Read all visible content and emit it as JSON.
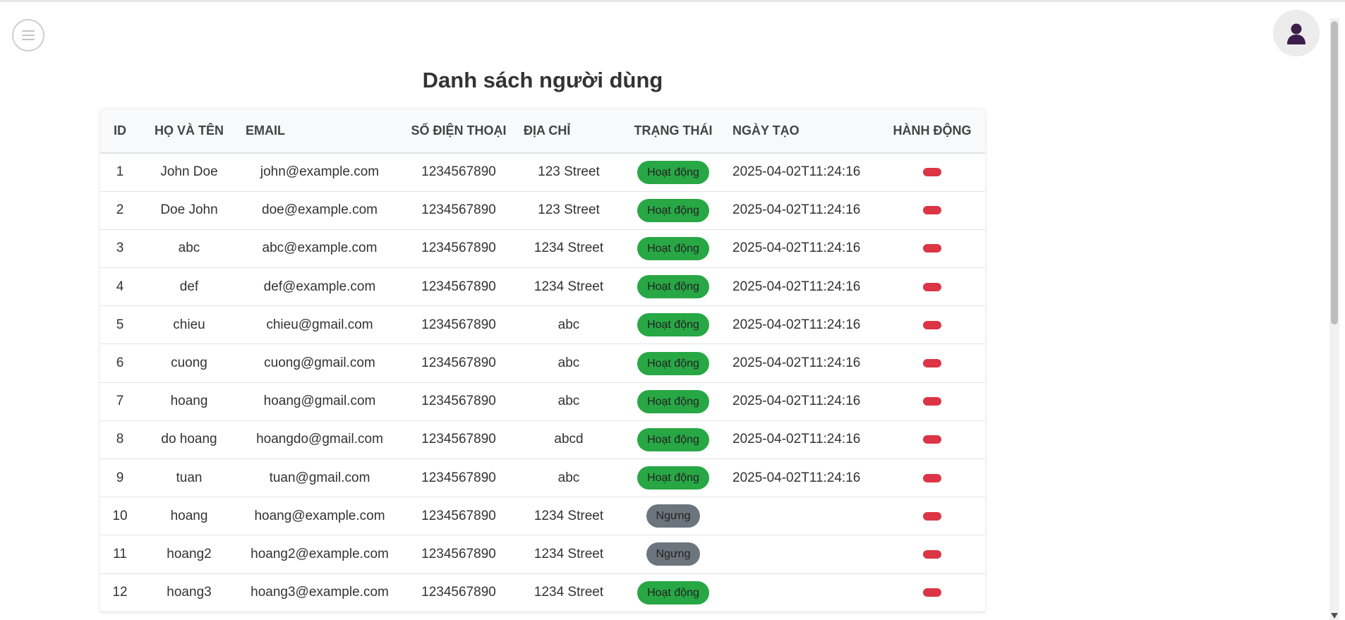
{
  "page": {
    "title": "Danh sách người dùng"
  },
  "header": {
    "menu_icon": "hamburger-icon",
    "avatar_icon": "user-avatar-icon"
  },
  "table": {
    "columns": [
      "ID",
      "HỌ VÀ TÊN",
      "EMAIL",
      "SỐ ĐIỆN THOẠI",
      "ĐỊA CHỈ",
      "TRẠNG THÁI",
      "NGÀY TẠO",
      "HÀNH ĐỘNG"
    ],
    "rows": [
      {
        "id": "1",
        "name": "John Doe",
        "email": "john@example.com",
        "phone": "1234567890",
        "address": "123 Street",
        "status": "Hoạt động",
        "status_type": "active",
        "created": "2025-04-02T11:24:16"
      },
      {
        "id": "2",
        "name": "Doe John",
        "email": "doe@example.com",
        "phone": "1234567890",
        "address": "123 Street",
        "status": "Hoạt động",
        "status_type": "active",
        "created": "2025-04-02T11:24:16"
      },
      {
        "id": "3",
        "name": "abc",
        "email": "abc@example.com",
        "phone": "1234567890",
        "address": "1234 Street",
        "status": "Hoạt động",
        "status_type": "active",
        "created": "2025-04-02T11:24:16"
      },
      {
        "id": "4",
        "name": "def",
        "email": "def@example.com",
        "phone": "1234567890",
        "address": "1234 Street",
        "status": "Hoạt động",
        "status_type": "active",
        "created": "2025-04-02T11:24:16"
      },
      {
        "id": "5",
        "name": "chieu",
        "email": "chieu@gmail.com",
        "phone": "1234567890",
        "address": "abc",
        "status": "Hoạt động",
        "status_type": "active",
        "created": "2025-04-02T11:24:16"
      },
      {
        "id": "6",
        "name": "cuong",
        "email": "cuong@gmail.com",
        "phone": "1234567890",
        "address": "abc",
        "status": "Hoạt động",
        "status_type": "active",
        "created": "2025-04-02T11:24:16"
      },
      {
        "id": "7",
        "name": "hoang",
        "email": "hoang@gmail.com",
        "phone": "1234567890",
        "address": "abc",
        "status": "Hoạt động",
        "status_type": "active",
        "created": "2025-04-02T11:24:16"
      },
      {
        "id": "8",
        "name": "do hoang",
        "email": "hoangdo@gmail.com",
        "phone": "1234567890",
        "address": "abcd",
        "status": "Hoạt động",
        "status_type": "active",
        "created": "2025-04-02T11:24:16"
      },
      {
        "id": "9",
        "name": "tuan",
        "email": "tuan@gmail.com",
        "phone": "1234567890",
        "address": "abc",
        "status": "Hoạt động",
        "status_type": "active",
        "created": "2025-04-02T11:24:16"
      },
      {
        "id": "10",
        "name": "hoang",
        "email": "hoang@example.com",
        "phone": "1234567890",
        "address": "1234 Street",
        "status": "Ngưng",
        "status_type": "inactive",
        "created": ""
      },
      {
        "id": "11",
        "name": "hoang2",
        "email": "hoang2@example.com",
        "phone": "1234567890",
        "address": "1234 Street",
        "status": "Ngưng",
        "status_type": "inactive",
        "created": ""
      },
      {
        "id": "12",
        "name": "hoang3",
        "email": "hoang3@example.com",
        "phone": "1234567890",
        "address": "1234 Street",
        "status": "Hoạt động",
        "status_type": "active",
        "created": ""
      }
    ]
  },
  "colors": {
    "active": "#28a745",
    "inactive": "#6c757d",
    "delete": "#dc3545"
  }
}
